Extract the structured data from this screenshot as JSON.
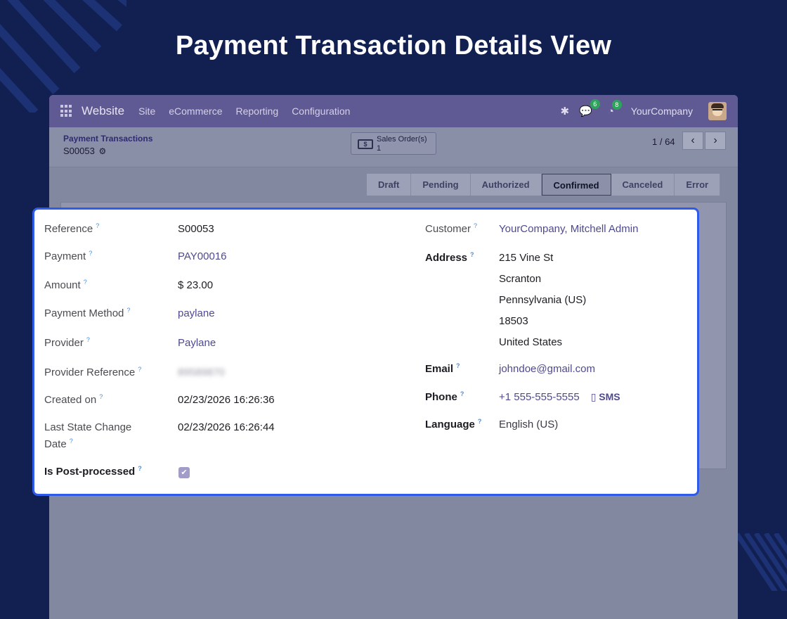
{
  "hero": {
    "title": "Payment Transaction Details View"
  },
  "navbar": {
    "app_name": "Website",
    "menu": [
      "Site",
      "eCommerce",
      "Reporting",
      "Configuration"
    ],
    "messages_count": "6",
    "activities_count": "8",
    "company": "YourCompany"
  },
  "control": {
    "breadcrumb_parent": "Payment Transactions",
    "breadcrumb_current": "S00053",
    "smart_button_label": "Sales Order(s)",
    "smart_button_count": "1",
    "pager": "1 / 64"
  },
  "statusbar": {
    "stages": [
      "Draft",
      "Pending",
      "Authorized",
      "Confirmed",
      "Canceled",
      "Error"
    ],
    "active": "Confirmed"
  },
  "fields_left": {
    "reference_label": "Reference",
    "reference_value": "S00053",
    "payment_label": "Payment",
    "payment_value": "PAY00016",
    "amount_label": "Amount",
    "amount_value": "$ 23.00",
    "method_label": "Payment Method",
    "method_value": "paylane",
    "provider_label": "Provider",
    "provider_value": "Paylane",
    "provider_ref_label": "Provider Reference",
    "provider_ref_value": "89589870",
    "created_label": "Created on",
    "created_value": "02/23/2026 16:26:36",
    "last_change_label_1": "Last State Change",
    "last_change_label_2": "Date",
    "last_change_value": "02/23/2026 16:26:44",
    "post_processed_label": "Is Post-processed",
    "post_processed_checked": true
  },
  "fields_right": {
    "customer_label": "Customer",
    "customer_value": "YourCompany, Mitchell Admin",
    "address_label": "Address",
    "address_lines": [
      "215 Vine St",
      "Scranton",
      "Pennsylvania (US)",
      "18503",
      "United States"
    ],
    "email_label": "Email",
    "email_value": "johndoe@gmail.com",
    "phone_label": "Phone",
    "phone_value": "+1 555-555-5555",
    "sms_label": "SMS",
    "language_label": "Language",
    "language_value": "English (US)"
  },
  "help_mark": "?"
}
